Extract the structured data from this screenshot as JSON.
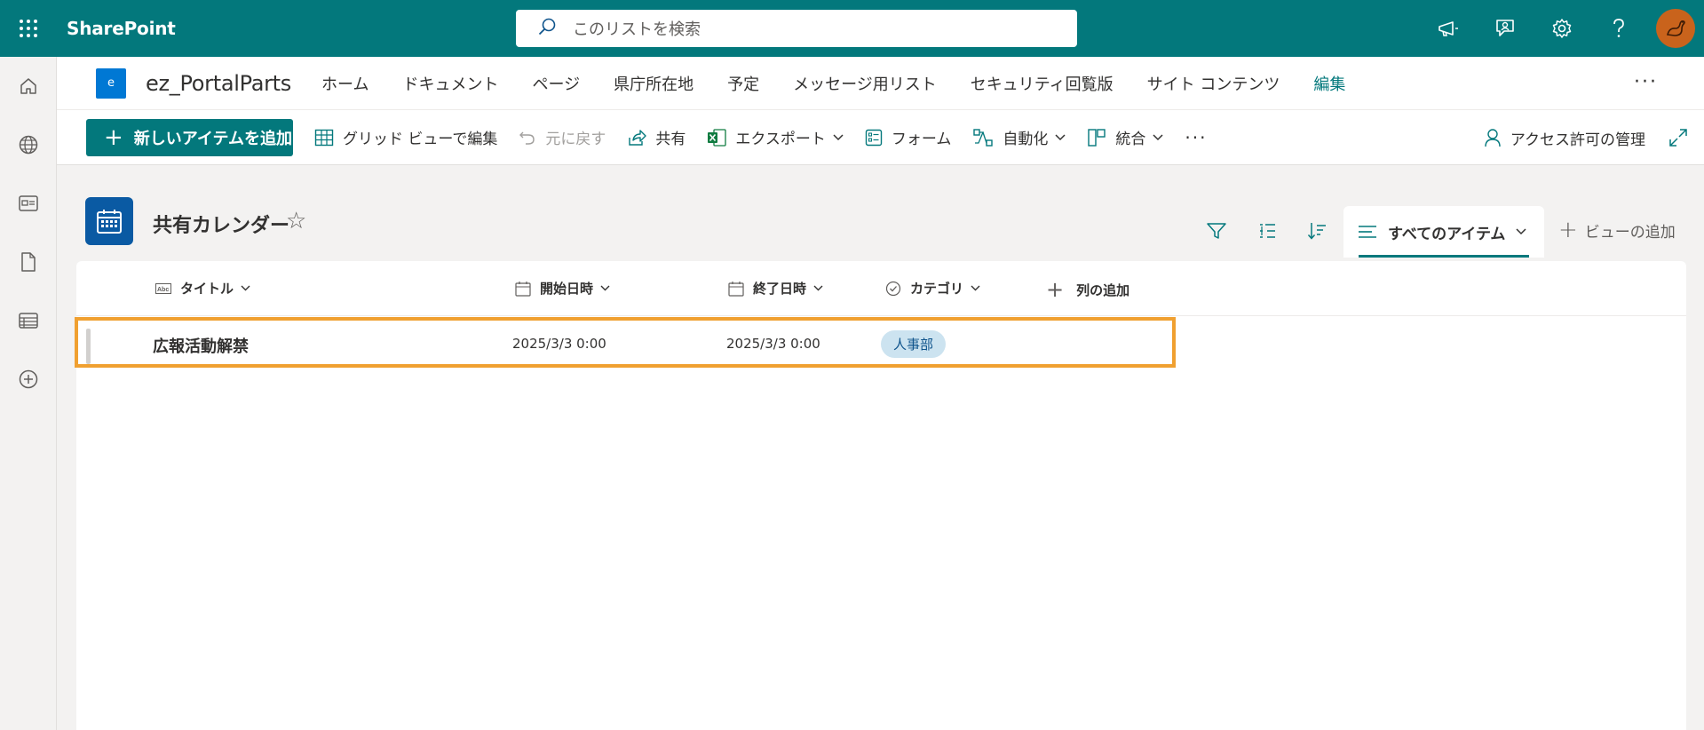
{
  "suite": {
    "brand": "SharePoint",
    "search_placeholder": "このリストを検索",
    "icons": [
      "megaphone-icon",
      "feedback-icon",
      "gear-icon",
      "help-icon",
      "avatar"
    ]
  },
  "rail": [
    "home-icon",
    "globe-icon",
    "news-icon",
    "document-icon",
    "list-icon",
    "add-icon"
  ],
  "site": {
    "logo_letter": "e",
    "title": "ez_PortalParts",
    "nav": [
      "ホーム",
      "ドキュメント",
      "ページ",
      "県庁所在地",
      "予定",
      "メッセージ用リスト",
      "セキュリティ回覧版",
      "サイト コンテンツ",
      "編集"
    ],
    "more": "···"
  },
  "commands": {
    "new_item": "新しいアイテムを追加",
    "grid_edit": "グリッド ビューで編集",
    "undo": "元に戻す",
    "share": "共有",
    "export": "エクスポート",
    "forms": "フォーム",
    "automate": "自動化",
    "integrate": "統合",
    "more": "···",
    "manage_access": "アクセス許可の管理"
  },
  "list": {
    "title": "共有カレンダー",
    "view_name": "すべてのアイテム",
    "add_view": "ビューの追加",
    "columns": {
      "title": "タイトル",
      "start": "開始日時",
      "end": "終了日時",
      "category": "カテゴリ",
      "add_column": "列の追加"
    },
    "rows": [
      {
        "title": "広報活動解禁",
        "start": "2025/3/3 0:00",
        "end": "2025/3/3 0:00",
        "category": "人事部"
      }
    ]
  },
  "colors": {
    "theme": "#03787c",
    "highlight": "#f0a030",
    "pill_bg": "#cce3f0"
  }
}
